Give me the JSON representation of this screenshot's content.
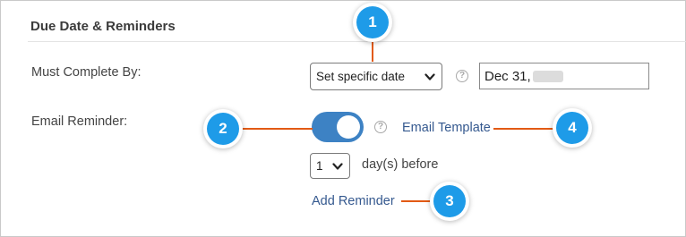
{
  "section": {
    "title": "Due Date & Reminders"
  },
  "must_complete": {
    "label": "Must Complete By:",
    "select_value": "Set specific date",
    "help_icon": "?",
    "date_value": "Dec 31,"
  },
  "email_reminder": {
    "label": "Email Reminder:",
    "toggle_on": true,
    "help_icon": "?",
    "template_link": "Email Template",
    "days_value": "1",
    "days_suffix": "day(s) before",
    "add_reminder_link": "Add Reminder"
  },
  "callouts": [
    "1",
    "2",
    "3",
    "4"
  ],
  "colors": {
    "toggle_active": "#3d82c4",
    "link": "#35598f",
    "badge": "#1e9be8",
    "connector": "#e25a14"
  }
}
